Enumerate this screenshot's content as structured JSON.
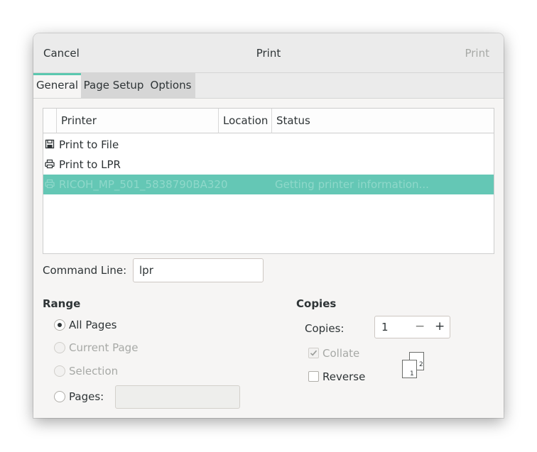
{
  "header": {
    "cancel_label": "Cancel",
    "title": "Print",
    "print_label": "Print"
  },
  "tabs": [
    {
      "label": "General",
      "active": true
    },
    {
      "label": "Page Setup",
      "active": false
    },
    {
      "label": "Options",
      "active": false
    }
  ],
  "printer_table": {
    "columns": [
      "Printer",
      "Location",
      "Status"
    ],
    "rows": [
      {
        "icon": "save-file-icon",
        "name": "Print to File",
        "location": "",
        "status": "",
        "selected": false
      },
      {
        "icon": "printer-icon",
        "name": "Print to LPR",
        "location": "",
        "status": "",
        "selected": false
      },
      {
        "icon": "printer-icon",
        "name": "RICOH_MP_501_5838790BA320",
        "location": "",
        "status": "Getting printer information...",
        "selected": true
      }
    ]
  },
  "command_line": {
    "label": "Command Line:",
    "value": "lpr"
  },
  "range": {
    "title": "Range",
    "options": [
      {
        "label": "All Pages",
        "checked": true,
        "enabled": true
      },
      {
        "label": "Current Page",
        "checked": false,
        "enabled": false
      },
      {
        "label": "Selection",
        "checked": false,
        "enabled": false
      },
      {
        "label": "Pages:",
        "checked": false,
        "enabled": true
      }
    ],
    "pages_value": ""
  },
  "copies": {
    "title": "Copies",
    "copies_label": "Copies:",
    "value": "1",
    "minus": "−",
    "plus": "+",
    "collate_label": "Collate",
    "collate_checked": true,
    "collate_enabled": false,
    "reverse_label": "Reverse",
    "reverse_checked": false,
    "collate_page_front": "1",
    "collate_page_back": "2"
  },
  "colors": {
    "accent": "#5bc8af",
    "selected_row": "#64c7b5"
  }
}
